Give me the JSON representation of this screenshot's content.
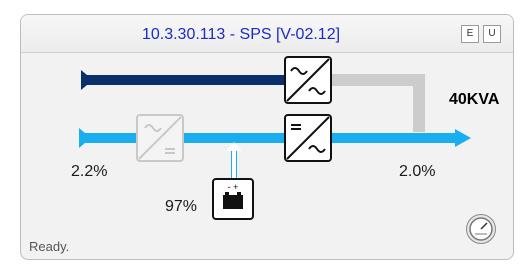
{
  "header": {
    "title": "10.3.30.113 - SPS [V-02.12]",
    "btn_e": "E",
    "btn_u": "U"
  },
  "diagram": {
    "rating": "40KVA",
    "input_left_pct": "2.2%",
    "output_right_pct": "2.0%",
    "battery_pct": "97%",
    "battery_terminals": "- +"
  },
  "status": "Ready.",
  "icons": {
    "bypass_converter": "ac-dc-converter-icon",
    "rectifier": "ac-dc-converter-icon",
    "inverter": "dc-ac-converter-icon",
    "battery": "battery-icon",
    "meter": "gauge-icon"
  },
  "colors": {
    "bypass_line": "#0b2f6a",
    "main_line": "#19aef0",
    "inactive_path": "#cccccc"
  }
}
